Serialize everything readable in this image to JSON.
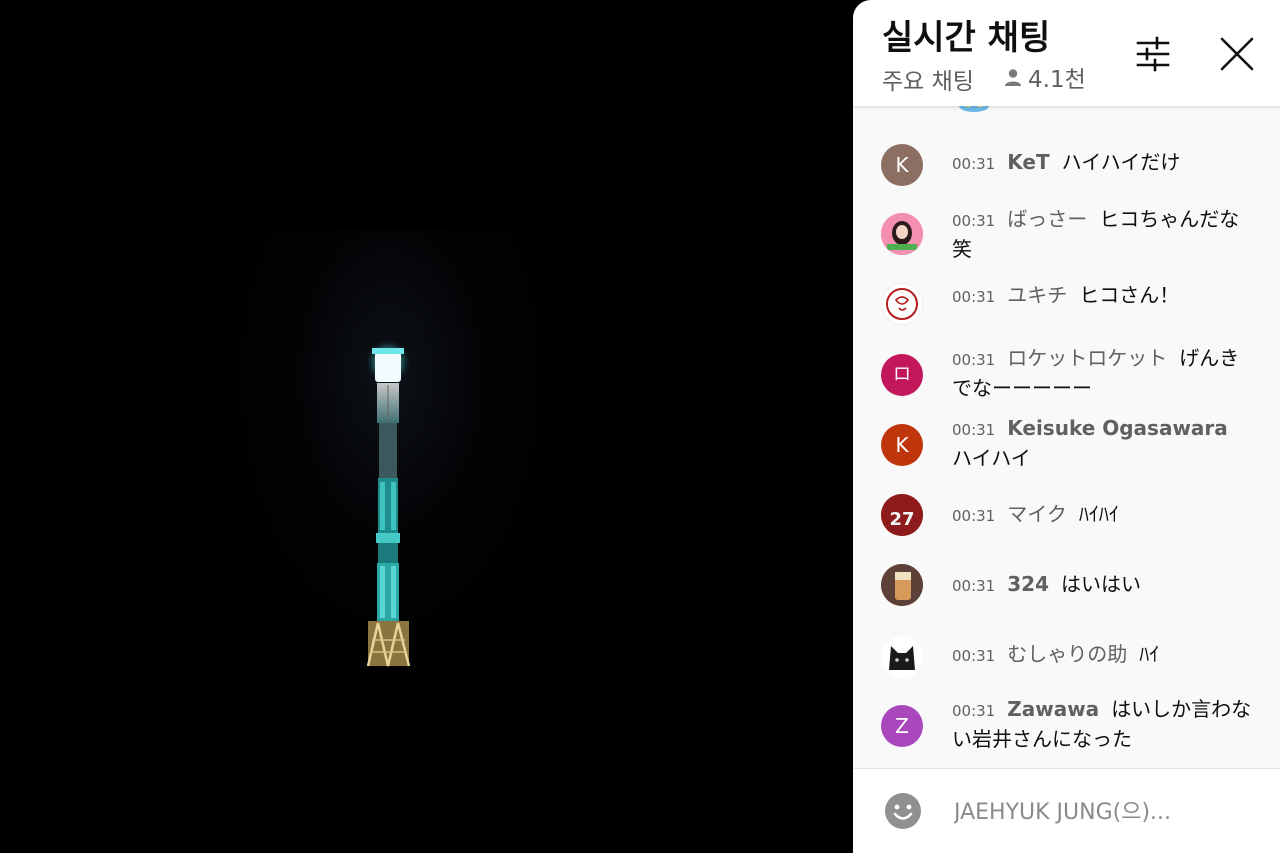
{
  "chat": {
    "title": "실시간 채팅",
    "mode": "주요 채팅",
    "viewer_count": "4.1천",
    "input_placeholder": "JAEHYUK JUNG(으)...",
    "messages": [
      {
        "time": "00:31",
        "author": "KeT",
        "author_bold": true,
        "text": "ハイハイだけ",
        "avatar_letter": "K",
        "avatar_color": "#8d6e63"
      },
      {
        "time": "00:31",
        "author": "ばっさー",
        "author_bold": false,
        "text": "ヒコちゃんだな笑",
        "avatar_letter": "",
        "avatar_color": "#f06292"
      },
      {
        "time": "00:31",
        "author": "ユキチ",
        "author_bold": false,
        "text": "ヒコさん！",
        "avatar_letter": "",
        "avatar_color": "#ffffff"
      },
      {
        "time": "00:31",
        "author": "ロケットロケット",
        "author_bold": false,
        "text": "げんきでなーーーーー",
        "avatar_letter": "ロ",
        "avatar_color": "#c2185b"
      },
      {
        "time": "00:31",
        "author": "Keisuke Ogasawara",
        "author_bold": true,
        "text": "ハイハイ",
        "avatar_letter": "K",
        "avatar_color": "#bf360c"
      },
      {
        "time": "00:31",
        "author": "マイク",
        "author_bold": false,
        "text": "ﾊｲﾊｲ",
        "avatar_letter": "",
        "avatar_color": "#b71c1c"
      },
      {
        "time": "00:31",
        "author": "324",
        "author_bold": true,
        "text": "はいはい",
        "avatar_letter": "",
        "avatar_color": "#8d6e63"
      },
      {
        "time": "00:31",
        "author": "むしゃりの助",
        "author_bold": false,
        "text": "ﾊｲ",
        "avatar_letter": "",
        "avatar_color": "#ffffff"
      },
      {
        "time": "00:31",
        "author": "Zawawa",
        "author_bold": true,
        "text": "はいしか言わない岩井さんになった",
        "avatar_letter": "Z",
        "avatar_color": "#ab47bc"
      }
    ]
  }
}
